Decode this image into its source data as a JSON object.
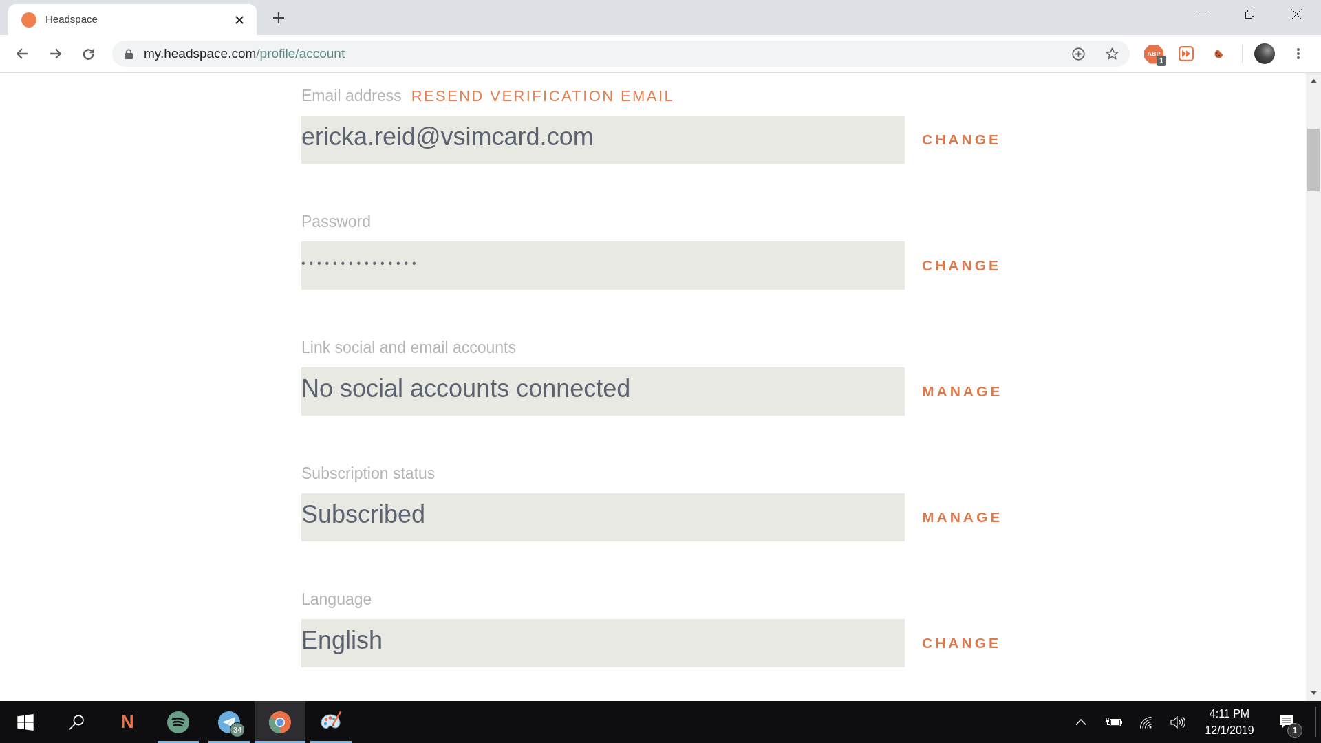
{
  "browser": {
    "tab": {
      "title": "Headspace",
      "selected": true
    },
    "address": {
      "host": "my.headspace.com",
      "path": "/profile/account"
    },
    "adblock": {
      "label": "ABP",
      "badge": "1"
    }
  },
  "account_fields": [
    {
      "label": "Email address",
      "link": "RESEND VERIFICATION EMAIL",
      "kind": "text",
      "value": "ericka.reid@vsimcard.com",
      "action": "CHANGE"
    },
    {
      "label": "Password",
      "kind": "password",
      "value": "•••••••••••••••",
      "action": "CHANGE"
    },
    {
      "label": "Link social and email accounts",
      "kind": "text",
      "value": "No social accounts connected",
      "action": "MANAGE"
    },
    {
      "label": "Subscription status",
      "kind": "text",
      "value": "Subscribed",
      "action": "MANAGE"
    },
    {
      "label": "Language",
      "kind": "text",
      "value": "English",
      "action": "CHANGE"
    }
  ],
  "taskbar": {
    "apps": [
      {
        "label": "N",
        "running": false,
        "selected": false
      },
      {
        "running": true,
        "selected": false
      },
      {
        "running": true,
        "selected": false,
        "badge": "34"
      },
      {
        "running": true,
        "selected": true
      },
      {
        "running": true,
        "selected": false
      }
    ],
    "clock": {
      "time": "4:11 PM",
      "date": "12/1/2019"
    },
    "notifications": {
      "badge": "1"
    }
  }
}
